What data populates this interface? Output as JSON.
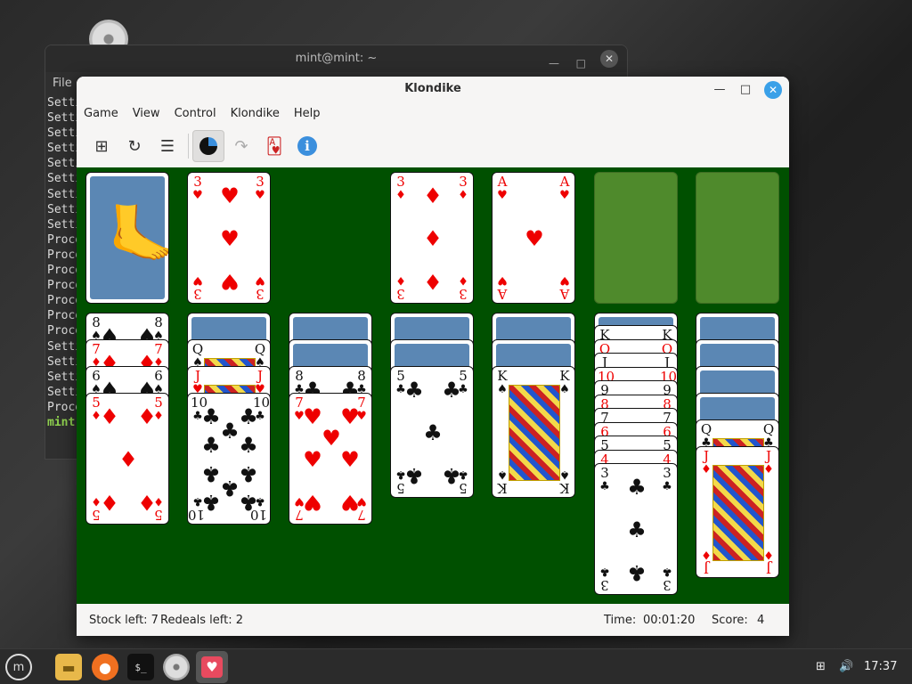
{
  "terminal": {
    "title": "mint@mint: ~",
    "menu_file": "File",
    "lines": [
      "Setti",
      "Setti",
      "Setti",
      "Setti",
      "Setti",
      "Setti",
      "Setti",
      "Setti",
      "Setti",
      "Proce",
      "Proce",
      "Proce",
      "Proce",
      "Proce",
      "Proce",
      "Proce",
      "Setti",
      "Setti",
      "Setti",
      "Setti",
      "Proce"
    ],
    "prompt": "mint("
  },
  "window": {
    "title": "Klondike",
    "menu": [
      "Game",
      "View",
      "Control",
      "Klondike",
      "Help"
    ],
    "toolbar": {
      "new_game": "new-game-icon",
      "restart": "restart-icon",
      "select_game": "list-icon",
      "undo": "undo-icon",
      "redo": "redo-icon",
      "hint": "hint-cards-icon",
      "info": "i"
    }
  },
  "board": {
    "stock": {
      "type": "back"
    },
    "waste": {
      "rank": "3",
      "suit": "♥",
      "color": "red"
    },
    "foundations": [
      {
        "rank": "3",
        "suit": "♦",
        "color": "red"
      },
      {
        "rank": "A",
        "suit": "♥",
        "color": "red"
      },
      {
        "empty": true
      },
      {
        "empty": true
      }
    ],
    "tableau": [
      {
        "visible": [
          {
            "rank": "8",
            "suit": "♠",
            "color": "black"
          },
          {
            "rank": "7",
            "suit": "♦",
            "color": "red"
          },
          {
            "rank": "6",
            "suit": "♠",
            "color": "black"
          },
          {
            "rank": "5",
            "suit": "♦",
            "color": "red"
          }
        ]
      },
      {
        "visible": [
          {
            "rank": "Q",
            "suit": "♠",
            "color": "black"
          },
          {
            "rank": "J",
            "suit": "♥",
            "color": "red"
          },
          {
            "rank": "10",
            "suit": "♣",
            "color": "black"
          }
        ]
      },
      {
        "visible": [
          {
            "rank": "8",
            "suit": "♣",
            "color": "black"
          },
          {
            "rank": "7",
            "suit": "♥",
            "color": "red"
          }
        ]
      },
      {
        "visible": [
          {
            "rank": "5",
            "suit": "♣",
            "color": "black"
          }
        ]
      },
      {
        "visible": [
          {
            "rank": "K",
            "suit": "♠",
            "color": "black"
          }
        ]
      },
      {
        "visible": [
          {
            "rank": "K",
            "suit": "♠",
            "color": "black"
          },
          {
            "rank": "Q",
            "suit": "♦",
            "color": "red"
          },
          {
            "rank": "J",
            "suit": "♠",
            "color": "black"
          },
          {
            "rank": "10",
            "suit": "♦",
            "color": "red"
          },
          {
            "rank": "9",
            "suit": "♠",
            "color": "black"
          },
          {
            "rank": "8",
            "suit": "♦",
            "color": "red"
          },
          {
            "rank": "7",
            "suit": "♠",
            "color": "black"
          },
          {
            "rank": "6",
            "suit": "♥",
            "color": "red"
          },
          {
            "rank": "5",
            "suit": "♠",
            "color": "black"
          },
          {
            "rank": "4",
            "suit": "♥",
            "color": "red"
          },
          {
            "rank": "3",
            "suit": "♣",
            "color": "black"
          }
        ]
      },
      {
        "visible": [
          {
            "rank": "Q",
            "suit": "♣",
            "color": "black"
          },
          {
            "rank": "J",
            "suit": "♦",
            "color": "red"
          }
        ]
      }
    ]
  },
  "status": {
    "stock_left": "Stock left: 7",
    "redeals_left": "Redeals left: 2",
    "time_label": "Time:",
    "time_value": "00:01:20",
    "score_label": "Score:",
    "score_value": "4"
  },
  "taskbar": {
    "clock": "17:37",
    "apps": [
      "menu-icon",
      "files-icon",
      "firefox-icon",
      "terminal-icon",
      "disc-icon",
      "solitaire-icon"
    ]
  },
  "colors": {
    "felt": "#005000",
    "card_back": "#5b87b4",
    "empty_slot": "#4f8a2c",
    "close_button": "#3aa0e8"
  }
}
